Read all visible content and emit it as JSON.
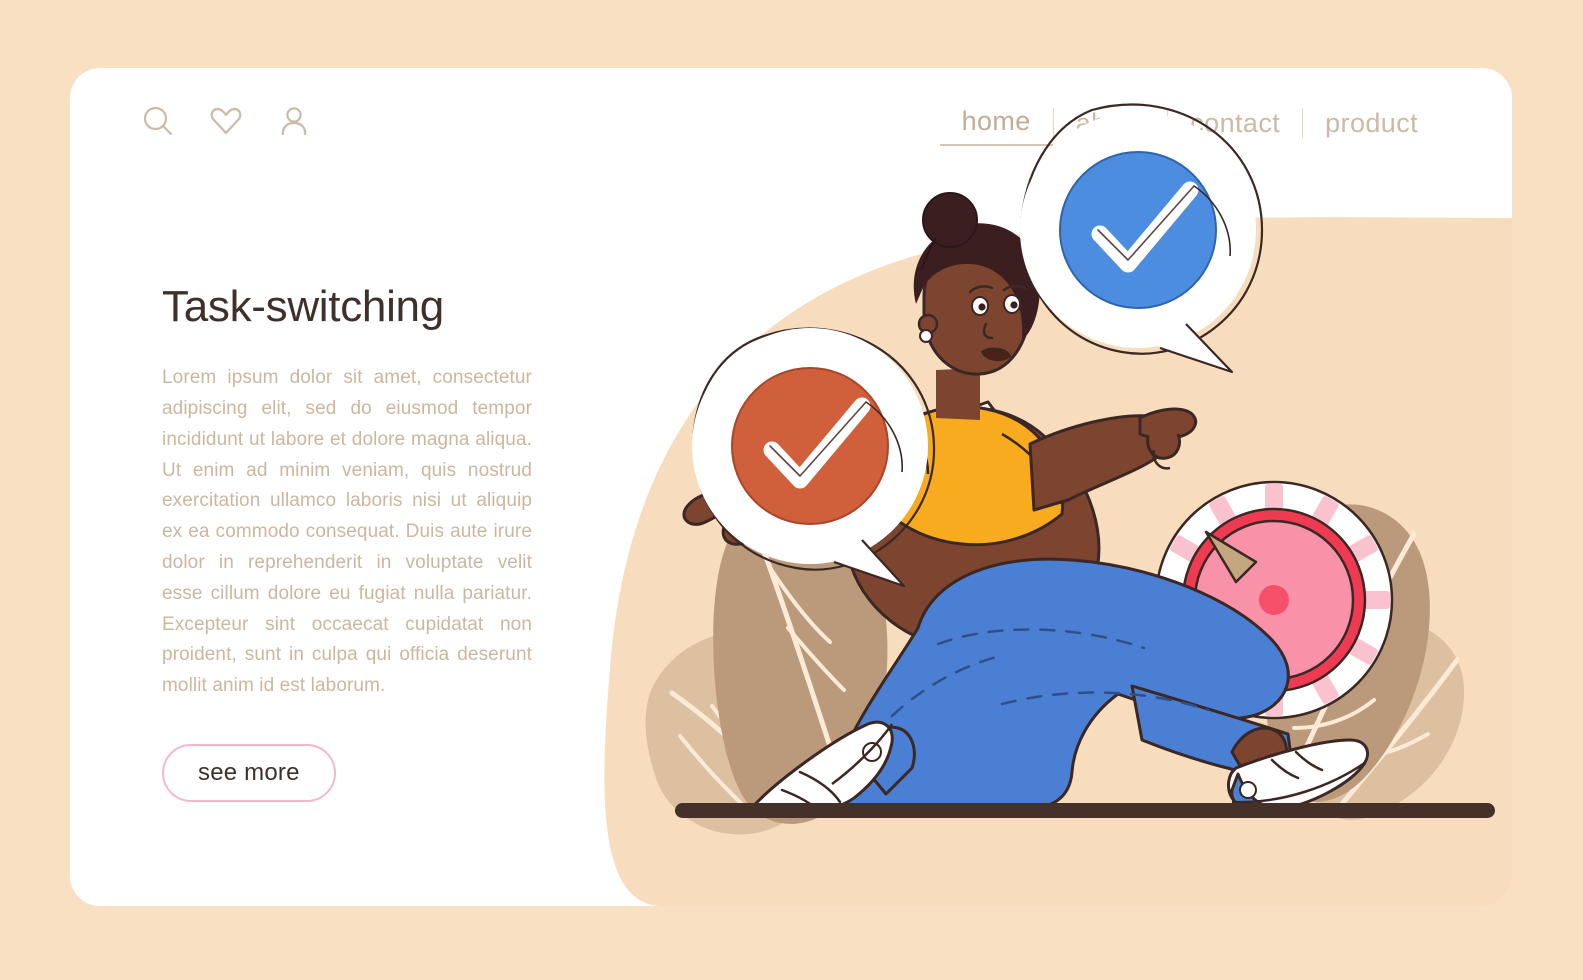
{
  "theme": {
    "page_background": "#f9e0c3",
    "card_background": "#ffffff",
    "title_color": "#3f302c",
    "body_text_color": "#cbb79f",
    "nav_color": "#cdbaa6",
    "button_border_color": "#f3b9cb",
    "accent_orange": "#d0603c",
    "accent_blue": "#4c8de0",
    "accent_pink": "#f58aa0",
    "accent_red": "#ef3b52",
    "shirt_yellow": "#f9ab1f",
    "jeans_blue": "#4a7fd4",
    "skin_brown": "#7d4430",
    "hair_dark": "#3b1f20",
    "leaf_tan": "#bb9a7c",
    "leaf_tan_light": "#d9bb9b",
    "blob_peach": "#f7ddbd",
    "ground_brown": "#45302a"
  },
  "header": {
    "icons": [
      {
        "name": "search-icon",
        "label": "search"
      },
      {
        "name": "heart-icon",
        "label": "favorites"
      },
      {
        "name": "user-icon",
        "label": "account"
      }
    ],
    "nav": [
      {
        "label": "home",
        "active": true
      },
      {
        "label": "about",
        "active": false
      },
      {
        "label": "contact",
        "active": false
      },
      {
        "label": "product",
        "active": false
      }
    ]
  },
  "hero": {
    "title": "Task-switching",
    "body": "Lorem ipsum dolor sit amet, consectetur adipiscing elit, sed do eiusmod tempor incididunt ut labore et dolore magna aliqua. Ut enim ad minim veniam, quis nostrud exercitation ullamco laboris nisi ut aliquip ex ea commodo consequat. Duis aute irure dolor in reprehenderit in voluptate velit esse cillum dolore eu fugiat nulla pariatur. Excepteur sint occaecat cupidatat non proident, sunt in culpa qui officia deserunt mollit anim id est laborum.",
    "cta_label": "see more"
  },
  "illustration": {
    "description": "Woman kneeling and pointing in two directions with two check-mark speech bubbles and a large pink timer dial",
    "elements": [
      {
        "name": "check-bubble-orange",
        "color": "#d0603c"
      },
      {
        "name": "check-bubble-blue",
        "color": "#4c8de0"
      },
      {
        "name": "timer-dial",
        "color": "#f58aa0"
      },
      {
        "name": "character",
        "color": "#7d4430"
      },
      {
        "name": "leaf-left",
        "color": "#bb9a7c"
      },
      {
        "name": "leaf-right",
        "color": "#bb9a7c"
      },
      {
        "name": "ground-line",
        "color": "#45302a"
      }
    ]
  }
}
